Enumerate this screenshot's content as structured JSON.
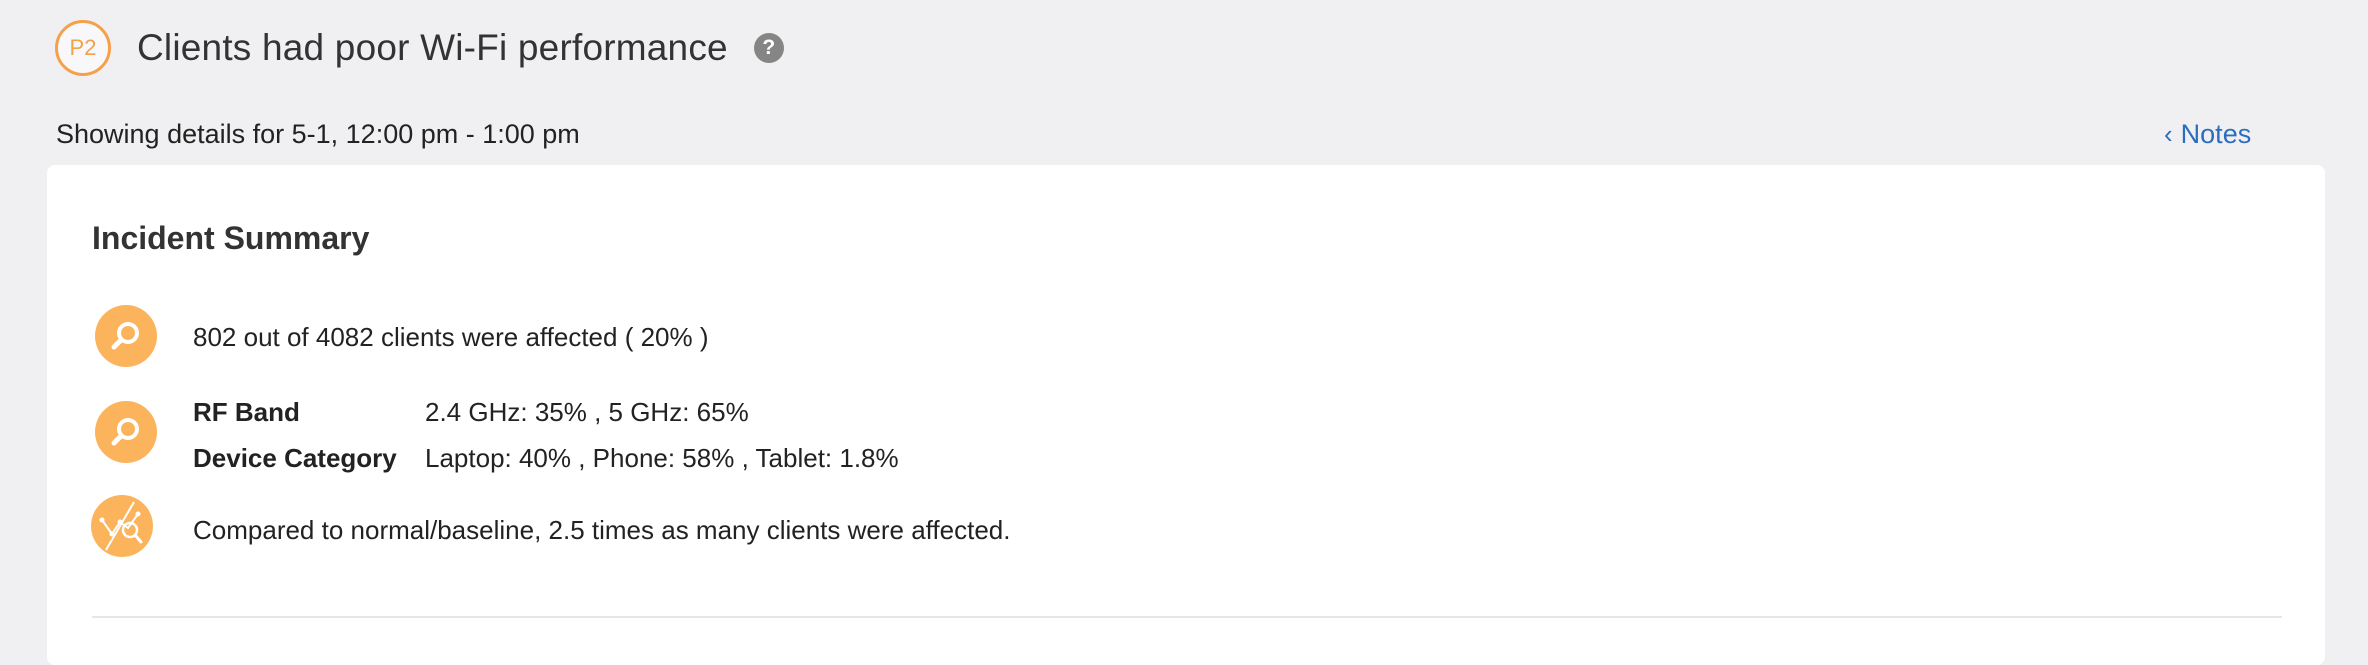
{
  "incident": {
    "priority": "P2",
    "title": "Clients had poor Wi-Fi performance",
    "help_icon": "?"
  },
  "details": {
    "showing": "Showing details for 5-1, 12:00 pm - 1:00 pm",
    "notes_label": "Notes"
  },
  "summary": {
    "title": "Incident Summary",
    "affected_text": "802 out of 4082 clients were affected ( 20% )",
    "rf_band_label": "RF Band",
    "rf_band_value": "2.4 GHz: 35% , 5 GHz: 65%",
    "device_category_label": "Device Category",
    "device_category_value": "Laptop: 40% , Phone: 58% , Tablet: 1.8%",
    "baseline_text": "Compared to normal/baseline, 2.5 times as many clients were affected."
  },
  "colors": {
    "accent_orange": "#f5a04b",
    "icon_orange": "#fbb45c",
    "link_blue": "#2a6ebd"
  }
}
